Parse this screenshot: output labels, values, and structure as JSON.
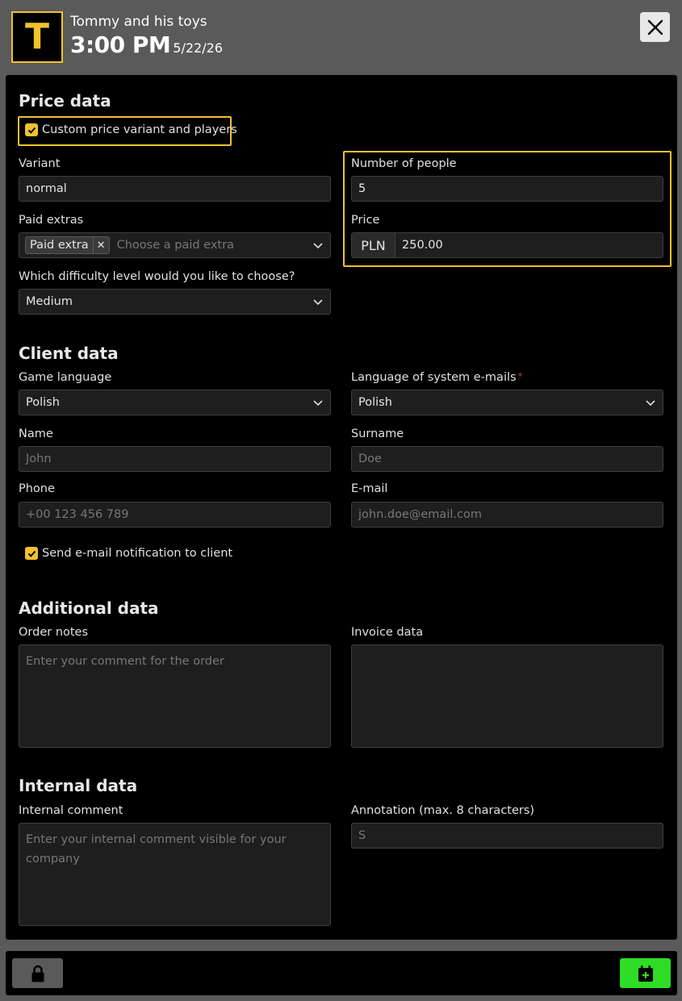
{
  "header": {
    "logo_letter": "T",
    "title": "Tommy and his toys",
    "time": "3:00 PM",
    "date": "5/22/26",
    "close_icon": "close-icon"
  },
  "price_data": {
    "section_title": "Price data",
    "custom_checkbox_label": "Custom price variant and players",
    "custom_checkbox_checked": true,
    "variant_label": "Variant",
    "variant_value": "normal",
    "people_label": "Number of people",
    "people_value": "5",
    "extras_label": "Paid extras",
    "extras_tag": "Paid extra",
    "extras_placeholder": "Choose a paid extra",
    "price_label": "Price",
    "price_currency": "PLN",
    "price_value": "250.00",
    "difficulty_label": "Which difficulty level would you like to choose?",
    "difficulty_value": "Medium"
  },
  "client_data": {
    "section_title": "Client data",
    "game_language_label": "Game language",
    "game_language_value": "Polish",
    "email_language_label": "Language of system e-mails",
    "email_language_required": "*",
    "email_language_value": "Polish",
    "name_label": "Name",
    "name_placeholder": "John",
    "surname_label": "Surname",
    "surname_placeholder": "Doe",
    "phone_label": "Phone",
    "phone_placeholder": "+00 123 456 789",
    "email_label": "E-mail",
    "email_placeholder": "john.doe@email.com",
    "notify_label": "Send e-mail notification to client",
    "notify_checked": true
  },
  "additional_data": {
    "section_title": "Additional data",
    "order_notes_label": "Order notes",
    "order_notes_placeholder": "Enter your comment for the order",
    "invoice_label": "Invoice data",
    "invoice_placeholder": ""
  },
  "internal_data": {
    "section_title": "Internal data",
    "comment_label": "Internal comment",
    "comment_placeholder": "Enter your internal comment visible for your company",
    "annotation_label": "Annotation (max. 8 characters)",
    "annotation_placeholder": "S"
  },
  "footer": {
    "lock_icon": "lock-icon",
    "add_icon": "calendar-plus-icon"
  },
  "colors": {
    "accent": "#f2c12e",
    "confirm": "#2fdc26",
    "required": "#e03c3c"
  }
}
